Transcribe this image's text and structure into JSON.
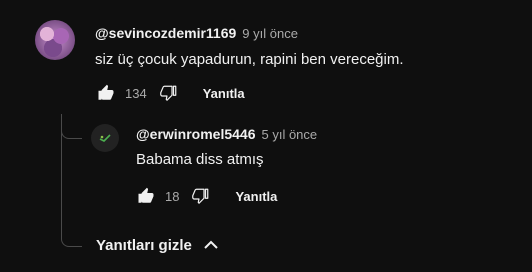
{
  "comment": {
    "author": "@sevincozdemir1169",
    "time": "9 yıl önce",
    "text": "siz üç çocuk yapadurun, rapini ben vereceğim.",
    "likes": "134",
    "reply_label": "Yanıtla"
  },
  "reply": {
    "author": "@erwinromel5446",
    "time": "5 yıl önce",
    "text": "Babama diss atmış",
    "likes": "18",
    "reply_label": "Yanıtla"
  },
  "hide_replies_label": "Yanıtları gizle",
  "colors": {
    "background": "#0f0f0f",
    "text": "#f1f1f1",
    "secondary": "#aaaaaa"
  },
  "icons": [
    "thumb-up-icon",
    "thumb-down-icon",
    "chevron-up-icon"
  ]
}
